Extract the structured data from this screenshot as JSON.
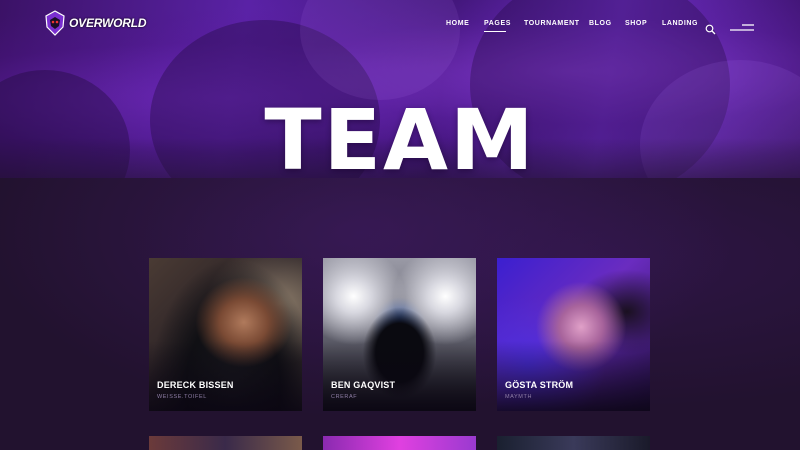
{
  "brand": {
    "logo_text": "OVERWORLD"
  },
  "nav": {
    "items": [
      {
        "label": "HOME"
      },
      {
        "label": "PAGES"
      },
      {
        "label": "TOURNAMENT"
      },
      {
        "label": "BLOG"
      },
      {
        "label": "SHOP"
      },
      {
        "label": "LANDING"
      }
    ],
    "active_item": "PAGES",
    "search_icon": "search-icon",
    "menu_icon": "hamburger-menu-icon"
  },
  "hero": {
    "title": "TEAM"
  },
  "team": {
    "members": [
      {
        "name": "DERECK BISSEN",
        "nickname": "WEISSE.TOIFEL"
      },
      {
        "name": "BEN GAQVIST",
        "nickname": "CRERAF"
      },
      {
        "name": "GÖSTA STRÖM",
        "nickname": "MAYMTH"
      }
    ]
  },
  "colors": {
    "accent": "#6a2cc0",
    "background": "#21112e",
    "nickname_text": "#8f7ea6"
  }
}
